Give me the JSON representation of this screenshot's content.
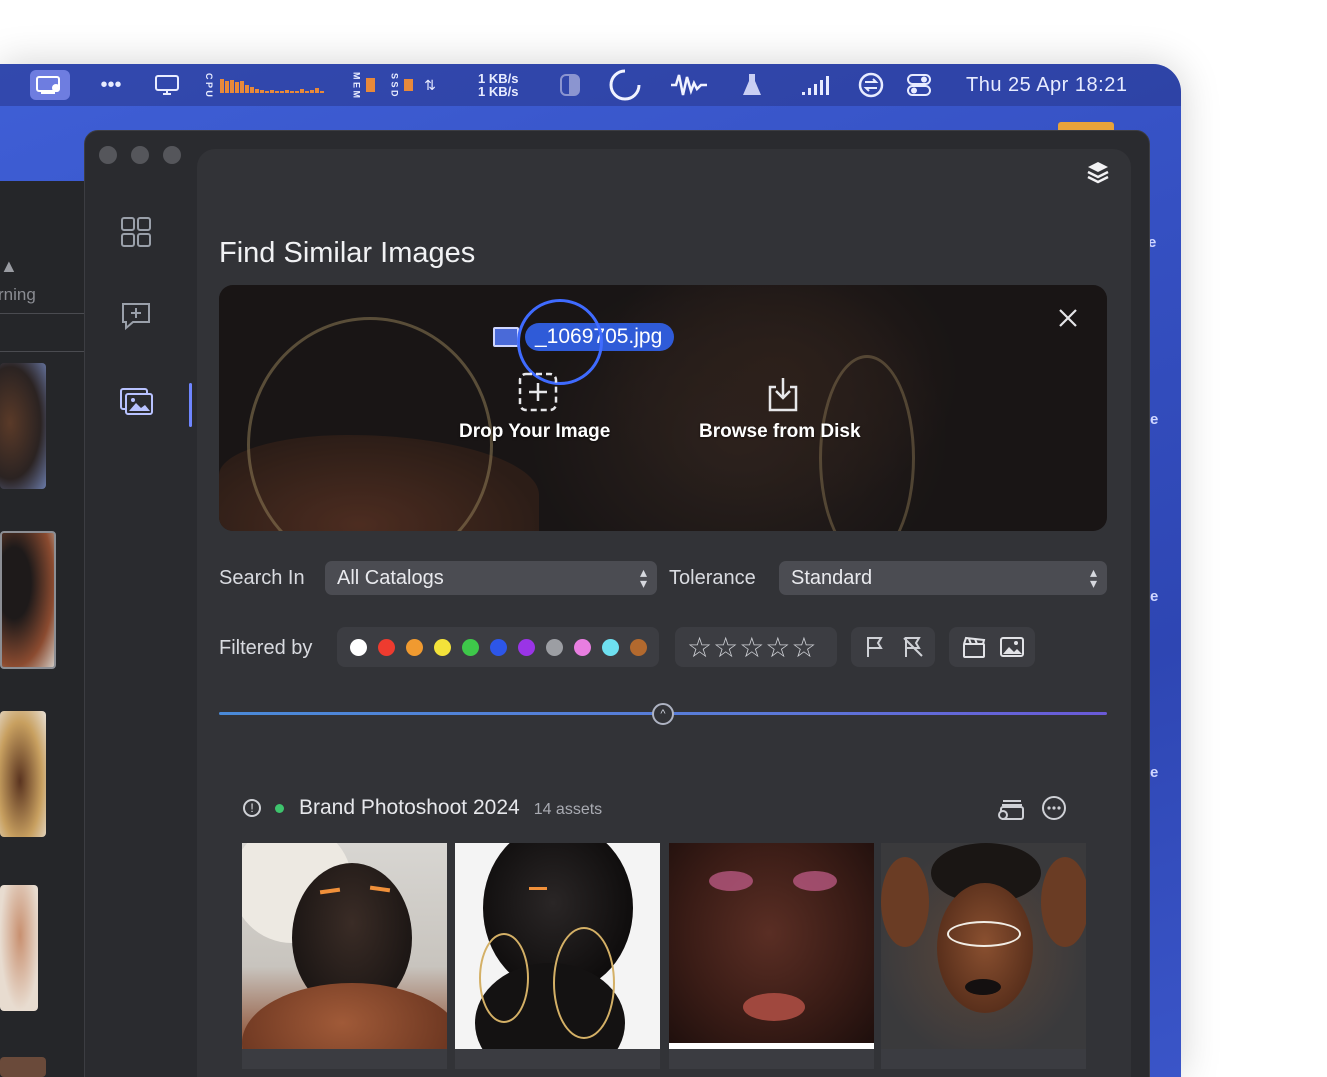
{
  "menubar": {
    "cpu_label": "C P U",
    "mem_label": "M E M",
    "ssd_label": "S S D",
    "net_up": "1 KB/s",
    "net_down": "1 KB/s",
    "clock": "Thu 25 Apr  18:21",
    "icons": [
      "screen-share-icon",
      "more-icon",
      "display-icon",
      "cpu-icon",
      "memory-icon",
      "ssd-icon",
      "network-icon",
      "dark-mode-icon",
      "sync-icon",
      "waveform-icon",
      "flask-icon",
      "signal-icon",
      "switch-icon",
      "control-center-icon"
    ]
  },
  "background_window": {
    "partial_text": "rning"
  },
  "edge_labels": [
    "e",
    "e",
    "e",
    "e"
  ],
  "sidebar": {
    "items": [
      {
        "icon": "grid-icon"
      },
      {
        "icon": "ai-chat-icon"
      },
      {
        "icon": "similar-images-icon",
        "active": true
      }
    ]
  },
  "panel": {
    "title": "Find Similar Images",
    "dropzone": {
      "file_name": "_1069705.jpg",
      "drop_label": "Drop Your Image",
      "browse_label": "Browse from Disk"
    },
    "search_in_label": "Search In",
    "search_in_value": "All Catalogs",
    "tolerance_label": "Tolerance",
    "tolerance_value": "Standard",
    "filtered_by_label": "Filtered by",
    "color_labels": [
      "#ffffff",
      "#ee3b2f",
      "#f09a30",
      "#f3e23a",
      "#3ec84a",
      "#2d56e8",
      "#9a34e6",
      "#9c9ea3",
      "#e87ee0",
      "#6ee0f0",
      "#b2692e"
    ],
    "stars": "☆☆☆☆☆",
    "slider_value": 0.5,
    "group": {
      "name": "Brand Photoshoot 2024",
      "assets": "14 assets",
      "status_color": "#3ec46d"
    }
  }
}
